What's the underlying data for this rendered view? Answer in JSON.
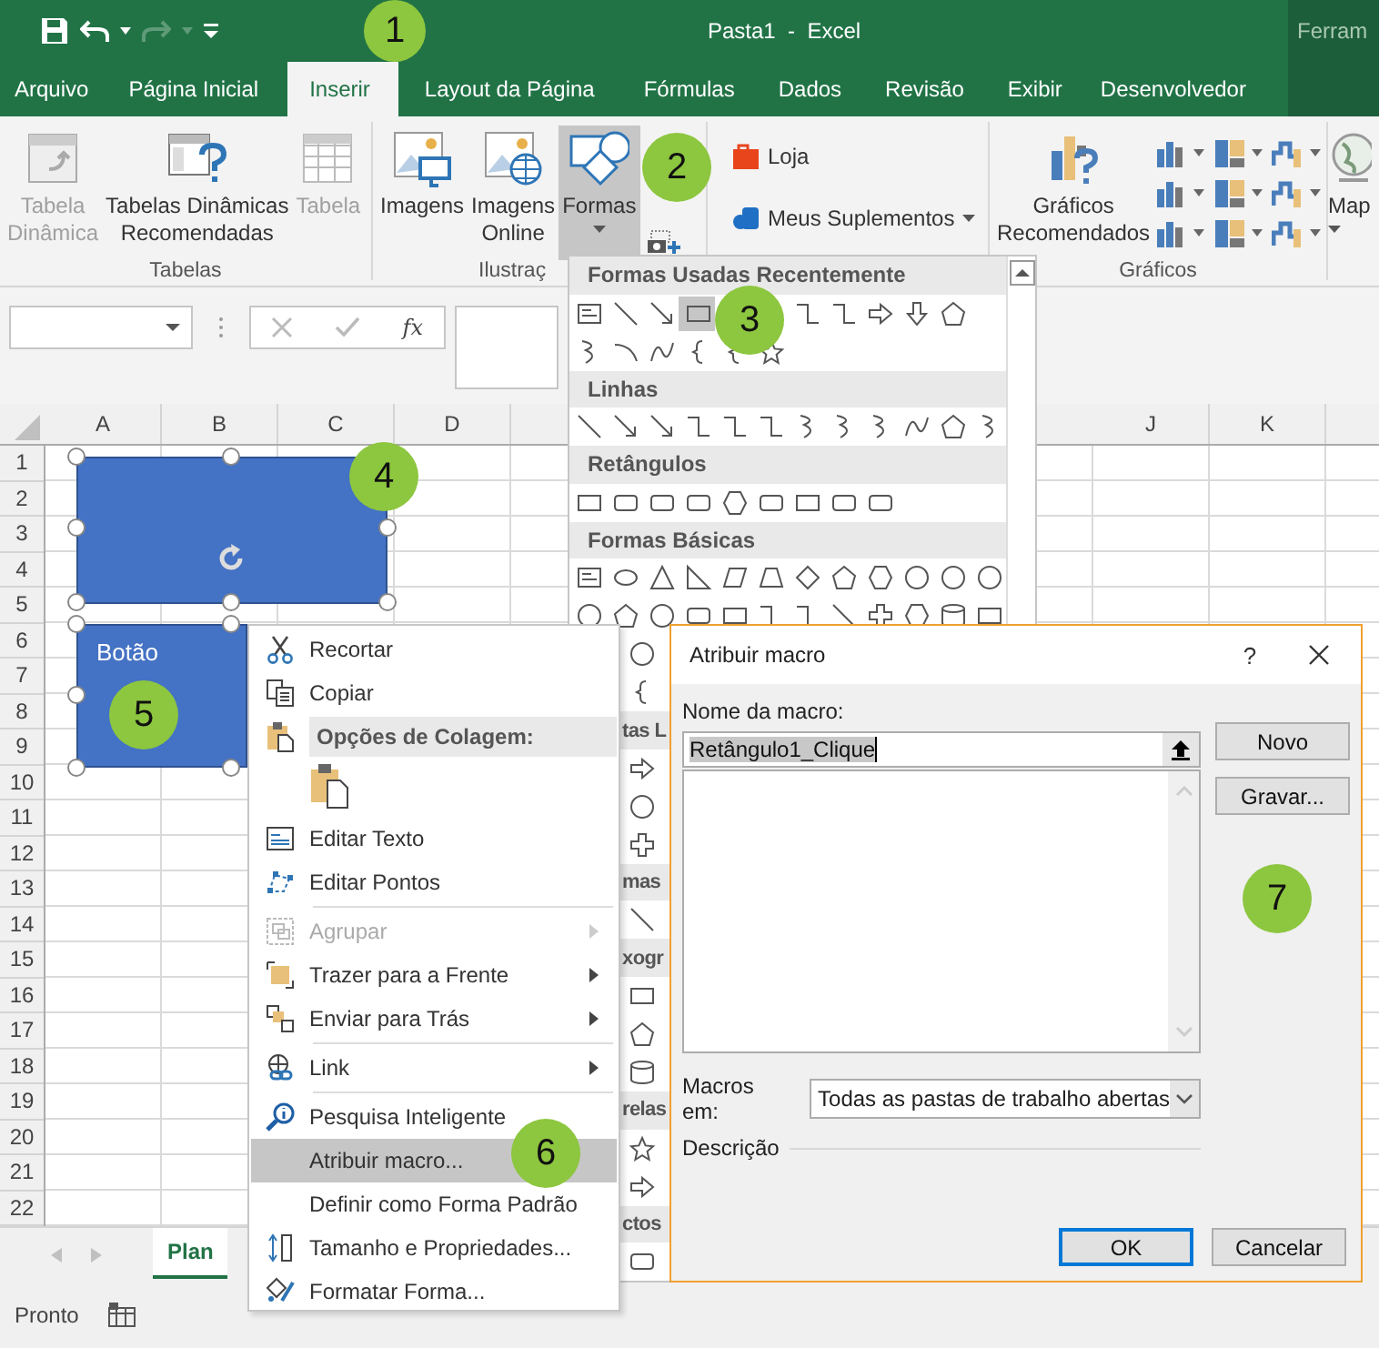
{
  "title_bar": {
    "title": "Pasta1  -  Excel",
    "context_label": "Ferram"
  },
  "ribbon_tabs": [
    {
      "label": "Arquivo",
      "selected": false
    },
    {
      "label": "Página Inicial",
      "selected": false
    },
    {
      "label": "Inserir",
      "selected": true
    },
    {
      "label": "Layout da Página",
      "selected": false
    },
    {
      "label": "Fórmulas",
      "selected": false
    },
    {
      "label": "Dados",
      "selected": false
    },
    {
      "label": "Revisão",
      "selected": false
    },
    {
      "label": "Exibir",
      "selected": false
    },
    {
      "label": "Desenvolvedor",
      "selected": false
    }
  ],
  "ribbon": {
    "groups": [
      {
        "label": "Tabelas",
        "buttons": [
          {
            "kind": "pivot",
            "label": "Tabela\nDinâmica",
            "disabled": true,
            "pressed": false
          },
          {
            "kind": "recommended-pivot",
            "label": "Tabelas Dinâmicas\nRecomendadas",
            "disabled": false,
            "pressed": false
          },
          {
            "kind": "table",
            "label": "Tabela",
            "disabled": true,
            "pressed": false
          }
        ]
      },
      {
        "label": "Ilustraç",
        "buttons": [
          {
            "kind": "pictures",
            "label": "Imagens",
            "disabled": false,
            "pressed": false
          },
          {
            "kind": "online-pictures",
            "label": "Imagens\nOnline",
            "disabled": false,
            "pressed": false
          },
          {
            "kind": "shapes",
            "label": "Formas",
            "disabled": false,
            "pressed": true
          },
          {
            "kind": "screenshot",
            "disabled": false,
            "pressed": false
          }
        ]
      },
      {
        "buttons": [
          {
            "kind": "store",
            "label": "Loja",
            "disabled": false,
            "pressed": false
          },
          {
            "kind": "addins",
            "label": "Meus Suplementos",
            "disabled": false,
            "pressed": false
          }
        ]
      },
      {
        "label": "Gráficos",
        "buttons": [
          {
            "kind": "recommended-charts",
            "label": "Gráficos\nRecomendados",
            "disabled": false,
            "pressed": false
          },
          {
            "kind": "chart-gallery",
            "disabled": false,
            "pressed": false
          }
        ]
      },
      {
        "buttons": [
          {
            "kind": "maps",
            "label": "Map",
            "disabled": false,
            "pressed": false
          }
        ]
      }
    ]
  },
  "formula_bar": {
    "function_label": "fx"
  },
  "sheet": {
    "left_columns": [
      "A",
      "B",
      "C",
      "D"
    ],
    "right_columns": [
      "J",
      "K"
    ],
    "rows": [
      "1",
      "2",
      "3",
      "4",
      "5",
      "6",
      "7",
      "8",
      "9",
      "10",
      "11",
      "12",
      "13",
      "14",
      "15",
      "16",
      "17",
      "18",
      "19",
      "20",
      "21",
      "22"
    ],
    "shapes": [
      {
        "kind": "rectangle",
        "selected": true
      },
      {
        "kind": "rectangle",
        "selected": true,
        "text": "Botão"
      }
    ]
  },
  "shapes_gallery": {
    "sections": [
      {
        "heading": "Formas Usadas Recentemente"
      },
      {
        "heading": "Linhas"
      },
      {
        "heading": "Retângulos"
      },
      {
        "heading": "Formas Básicas"
      },
      {
        "heading": "tas L"
      },
      {
        "heading": "mas"
      },
      {
        "heading": "xogr"
      },
      {
        "heading": "relas"
      },
      {
        "heading": "ctos"
      }
    ]
  },
  "context_menu": {
    "items": [
      {
        "kind": "command",
        "label": "Recortar",
        "disabled": false,
        "selected": false,
        "submenu": false,
        "separator": false
      },
      {
        "kind": "command",
        "label": "Copiar",
        "disabled": false,
        "selected": false,
        "submenu": false,
        "separator": false
      },
      {
        "kind": "header",
        "label": "Opções de Colagem:"
      },
      {
        "kind": "paste-options"
      },
      {
        "kind": "command",
        "label": "Editar Texto",
        "disabled": false,
        "selected": false,
        "submenu": false,
        "separator": false
      },
      {
        "kind": "command",
        "label": "Editar Pontos",
        "disabled": false,
        "selected": false,
        "submenu": false,
        "separator": false
      },
      {
        "kind": "command",
        "label": "Agrupar",
        "disabled": true,
        "selected": false,
        "submenu": true,
        "separator": true
      },
      {
        "kind": "command",
        "label": "Trazer para a Frente",
        "disabled": false,
        "selected": false,
        "submenu": true,
        "separator": false
      },
      {
        "kind": "command",
        "label": "Enviar para Trás",
        "disabled": false,
        "selected": false,
        "submenu": true,
        "separator": false
      },
      {
        "kind": "command",
        "label": "Link",
        "disabled": false,
        "selected": false,
        "submenu": true,
        "separator": true
      },
      {
        "kind": "command",
        "label": "Pesquisa Inteligente",
        "disabled": false,
        "selected": false,
        "submenu": false,
        "separator": true
      },
      {
        "kind": "command",
        "label": "Atribuir macro...",
        "disabled": false,
        "selected": true,
        "submenu": false,
        "separator": false
      },
      {
        "kind": "command",
        "label": "Definir como Forma Padrão",
        "disabled": false,
        "selected": false,
        "submenu": false,
        "separator": false
      },
      {
        "kind": "command",
        "label": "Tamanho e Propriedades...",
        "disabled": false,
        "selected": false,
        "submenu": false,
        "separator": false
      },
      {
        "kind": "command",
        "label": "Formatar Forma...",
        "disabled": false,
        "selected": false,
        "submenu": false,
        "separator": false
      }
    ]
  },
  "dialog": {
    "title": "Atribuir macro",
    "help": "?",
    "name_label": "Nome da macro:",
    "name_value": "Retângulo1_Clique",
    "buttons_side": [
      "Novo",
      "Gravar..."
    ],
    "macros_in_label": "Macros em:",
    "macros_in_value": "Todas as pastas de trabalho abertas",
    "description_label": "Descrição",
    "ok": "OK",
    "cancel": "Cancelar"
  },
  "sheet_tabs": [
    {
      "label": "Plan",
      "selected": true
    }
  ],
  "status_bar": {
    "text": "Pronto"
  },
  "callouts": [
    "1",
    "2",
    "3",
    "4",
    "5",
    "6",
    "7"
  ]
}
